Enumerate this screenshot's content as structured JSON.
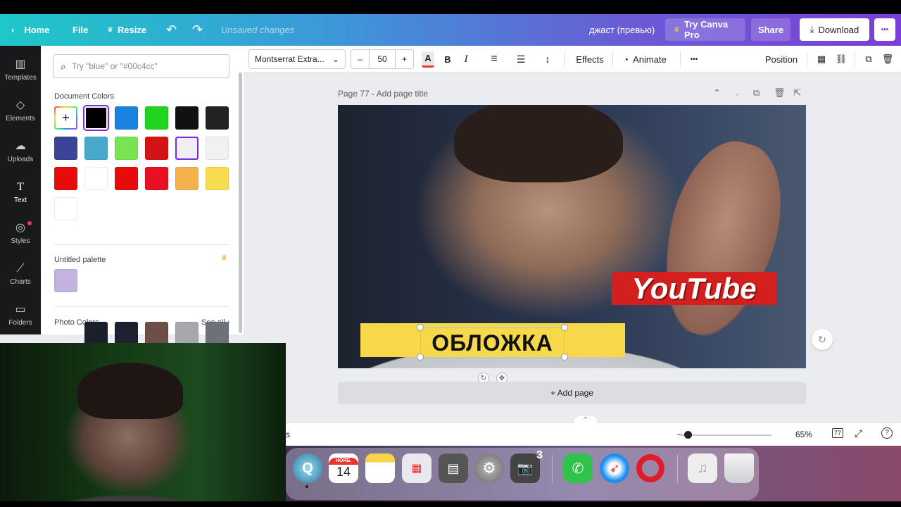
{
  "topbar": {
    "home": "Home",
    "file": "File",
    "resize": "Resize",
    "status": "Unsaved changes",
    "doc_title": "джаст (превью)",
    "try_pro": "Try Canva Pro",
    "share": "Share",
    "download": "Download",
    "more": "•••",
    "gradient_colors": [
      "#1ec8c8",
      "#7a3fd6"
    ]
  },
  "rail": {
    "items": [
      {
        "label": "Templates",
        "icon": "templates-icon"
      },
      {
        "label": "Elements",
        "icon": "elements-icon"
      },
      {
        "label": "Uploads",
        "icon": "uploads-icon"
      },
      {
        "label": "Text",
        "icon": "text-icon"
      },
      {
        "label": "Styles",
        "icon": "styles-icon"
      },
      {
        "label": "Charts",
        "icon": "charts-icon"
      },
      {
        "label": "Folders",
        "icon": "folders-icon"
      }
    ]
  },
  "panel": {
    "search_placeholder": "Try \"blue\" or \"#00c4cc\"",
    "document_colors_title": "Document Colors",
    "document_colors": [
      "#000000",
      "#1a82e0",
      "#20d420",
      "#111111",
      "#222222",
      "#3a4597",
      "#48a8cc",
      "#78e454",
      "#d41414",
      "#efeff2",
      "#eff1f2",
      "#e80b0b",
      "#ffffff",
      "#e80b0b",
      "#e81022",
      "#f5b14c",
      "#f6dc4e",
      "#ffffff"
    ],
    "untitled_palette_title": "Untitled palette",
    "palette_colors": [
      "#c3b3e0"
    ],
    "photo_colors_title": "Photo Colors",
    "see_all": "See all",
    "photo_colors": [
      "#1a1f2e",
      "#1e2130",
      "#6e4f48",
      "#a7a8ab",
      "#6e7178"
    ]
  },
  "editor_toolbar": {
    "font": "Montserrat Extra...",
    "size": "50",
    "minus": "–",
    "plus": "+",
    "bold": "B",
    "italic": "I",
    "effects": "Effects",
    "animate": "Animate",
    "more": "•••",
    "position": "Position"
  },
  "canvas": {
    "page_title": "Page 77 - Add page title",
    "youtube_text": "YouTube",
    "cover_text": "ОБЛОЖКА",
    "add_page": "+ Add page"
  },
  "status_bar": {
    "zoom": "65%",
    "page_number": "77",
    "cut_text": "s"
  },
  "dock": {
    "calendar_month": "НОЯБ.",
    "calendar_day": "14",
    "badge": "3"
  }
}
